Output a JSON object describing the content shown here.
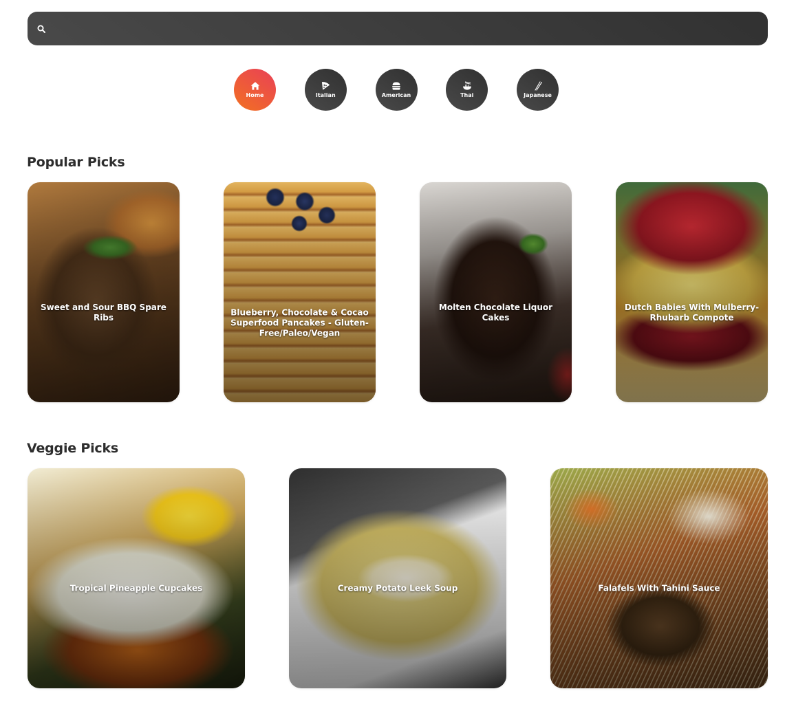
{
  "search": {
    "value": "",
    "placeholder": ""
  },
  "cuisines": [
    {
      "label": "Home",
      "icon": "home-icon",
      "active": true
    },
    {
      "label": "Italian",
      "icon": "pizza-icon",
      "active": false
    },
    {
      "label": "American",
      "icon": "burger-icon",
      "active": false
    },
    {
      "label": "Thai",
      "icon": "noodle-bowl-icon",
      "active": false
    },
    {
      "label": "Japanese",
      "icon": "chopsticks-icon",
      "active": false
    }
  ],
  "popular": {
    "heading": "Popular Picks",
    "items": [
      {
        "title": "Sweet and Sour BBQ Spare Ribs"
      },
      {
        "title": "Blueberry, Chocolate & Cocao Superfood Pancakes - Gluten-Free/Paleo/Vegan"
      },
      {
        "title": "Molten Chocolate Liquor Cakes"
      },
      {
        "title": "Dutch Babies With Mulberry-Rhubarb Compote"
      }
    ]
  },
  "veggie": {
    "heading": "Veggie Picks",
    "items": [
      {
        "title": "Tropical Pineapple Cupcakes"
      },
      {
        "title": "Creamy Potato Leek Soup"
      },
      {
        "title": "Falafels With Tahini Sauce"
      }
    ]
  },
  "colors": {
    "dark_gradient_start": "#494949",
    "dark_gradient_end": "#313131",
    "active_gradient_start": "#f27121",
    "active_gradient_end": "#e94057",
    "heading_text": "#2d2d2d"
  }
}
